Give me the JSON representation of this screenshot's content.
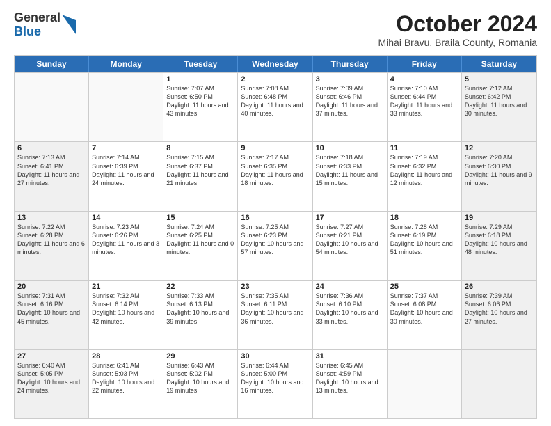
{
  "header": {
    "logo": {
      "general": "General",
      "blue": "Blue"
    },
    "month": "October 2024",
    "location": "Mihai Bravu, Braila County, Romania"
  },
  "weekdays": [
    "Sunday",
    "Monday",
    "Tuesday",
    "Wednesday",
    "Thursday",
    "Friday",
    "Saturday"
  ],
  "rows": [
    [
      {
        "day": "",
        "empty": true,
        "shaded": false
      },
      {
        "day": "",
        "empty": true,
        "shaded": false
      },
      {
        "day": "1",
        "empty": false,
        "shaded": false,
        "sunrise": "Sunrise: 7:07 AM",
        "sunset": "Sunset: 6:50 PM",
        "daylight": "Daylight: 11 hours and 43 minutes."
      },
      {
        "day": "2",
        "empty": false,
        "shaded": false,
        "sunrise": "Sunrise: 7:08 AM",
        "sunset": "Sunset: 6:48 PM",
        "daylight": "Daylight: 11 hours and 40 minutes."
      },
      {
        "day": "3",
        "empty": false,
        "shaded": false,
        "sunrise": "Sunrise: 7:09 AM",
        "sunset": "Sunset: 6:46 PM",
        "daylight": "Daylight: 11 hours and 37 minutes."
      },
      {
        "day": "4",
        "empty": false,
        "shaded": false,
        "sunrise": "Sunrise: 7:10 AM",
        "sunset": "Sunset: 6:44 PM",
        "daylight": "Daylight: 11 hours and 33 minutes."
      },
      {
        "day": "5",
        "empty": false,
        "shaded": true,
        "sunrise": "Sunrise: 7:12 AM",
        "sunset": "Sunset: 6:42 PM",
        "daylight": "Daylight: 11 hours and 30 minutes."
      }
    ],
    [
      {
        "day": "6",
        "empty": false,
        "shaded": true,
        "sunrise": "Sunrise: 7:13 AM",
        "sunset": "Sunset: 6:41 PM",
        "daylight": "Daylight: 11 hours and 27 minutes."
      },
      {
        "day": "7",
        "empty": false,
        "shaded": false,
        "sunrise": "Sunrise: 7:14 AM",
        "sunset": "Sunset: 6:39 PM",
        "daylight": "Daylight: 11 hours and 24 minutes."
      },
      {
        "day": "8",
        "empty": false,
        "shaded": false,
        "sunrise": "Sunrise: 7:15 AM",
        "sunset": "Sunset: 6:37 PM",
        "daylight": "Daylight: 11 hours and 21 minutes."
      },
      {
        "day": "9",
        "empty": false,
        "shaded": false,
        "sunrise": "Sunrise: 7:17 AM",
        "sunset": "Sunset: 6:35 PM",
        "daylight": "Daylight: 11 hours and 18 minutes."
      },
      {
        "day": "10",
        "empty": false,
        "shaded": false,
        "sunrise": "Sunrise: 7:18 AM",
        "sunset": "Sunset: 6:33 PM",
        "daylight": "Daylight: 11 hours and 15 minutes."
      },
      {
        "day": "11",
        "empty": false,
        "shaded": false,
        "sunrise": "Sunrise: 7:19 AM",
        "sunset": "Sunset: 6:32 PM",
        "daylight": "Daylight: 11 hours and 12 minutes."
      },
      {
        "day": "12",
        "empty": false,
        "shaded": true,
        "sunrise": "Sunrise: 7:20 AM",
        "sunset": "Sunset: 6:30 PM",
        "daylight": "Daylight: 11 hours and 9 minutes."
      }
    ],
    [
      {
        "day": "13",
        "empty": false,
        "shaded": true,
        "sunrise": "Sunrise: 7:22 AM",
        "sunset": "Sunset: 6:28 PM",
        "daylight": "Daylight: 11 hours and 6 minutes."
      },
      {
        "day": "14",
        "empty": false,
        "shaded": false,
        "sunrise": "Sunrise: 7:23 AM",
        "sunset": "Sunset: 6:26 PM",
        "daylight": "Daylight: 11 hours and 3 minutes."
      },
      {
        "day": "15",
        "empty": false,
        "shaded": false,
        "sunrise": "Sunrise: 7:24 AM",
        "sunset": "Sunset: 6:25 PM",
        "daylight": "Daylight: 11 hours and 0 minutes."
      },
      {
        "day": "16",
        "empty": false,
        "shaded": false,
        "sunrise": "Sunrise: 7:25 AM",
        "sunset": "Sunset: 6:23 PM",
        "daylight": "Daylight: 10 hours and 57 minutes."
      },
      {
        "day": "17",
        "empty": false,
        "shaded": false,
        "sunrise": "Sunrise: 7:27 AM",
        "sunset": "Sunset: 6:21 PM",
        "daylight": "Daylight: 10 hours and 54 minutes."
      },
      {
        "day": "18",
        "empty": false,
        "shaded": false,
        "sunrise": "Sunrise: 7:28 AM",
        "sunset": "Sunset: 6:19 PM",
        "daylight": "Daylight: 10 hours and 51 minutes."
      },
      {
        "day": "19",
        "empty": false,
        "shaded": true,
        "sunrise": "Sunrise: 7:29 AM",
        "sunset": "Sunset: 6:18 PM",
        "daylight": "Daylight: 10 hours and 48 minutes."
      }
    ],
    [
      {
        "day": "20",
        "empty": false,
        "shaded": true,
        "sunrise": "Sunrise: 7:31 AM",
        "sunset": "Sunset: 6:16 PM",
        "daylight": "Daylight: 10 hours and 45 minutes."
      },
      {
        "day": "21",
        "empty": false,
        "shaded": false,
        "sunrise": "Sunrise: 7:32 AM",
        "sunset": "Sunset: 6:14 PM",
        "daylight": "Daylight: 10 hours and 42 minutes."
      },
      {
        "day": "22",
        "empty": false,
        "shaded": false,
        "sunrise": "Sunrise: 7:33 AM",
        "sunset": "Sunset: 6:13 PM",
        "daylight": "Daylight: 10 hours and 39 minutes."
      },
      {
        "day": "23",
        "empty": false,
        "shaded": false,
        "sunrise": "Sunrise: 7:35 AM",
        "sunset": "Sunset: 6:11 PM",
        "daylight": "Daylight: 10 hours and 36 minutes."
      },
      {
        "day": "24",
        "empty": false,
        "shaded": false,
        "sunrise": "Sunrise: 7:36 AM",
        "sunset": "Sunset: 6:10 PM",
        "daylight": "Daylight: 10 hours and 33 minutes."
      },
      {
        "day": "25",
        "empty": false,
        "shaded": false,
        "sunrise": "Sunrise: 7:37 AM",
        "sunset": "Sunset: 6:08 PM",
        "daylight": "Daylight: 10 hours and 30 minutes."
      },
      {
        "day": "26",
        "empty": false,
        "shaded": true,
        "sunrise": "Sunrise: 7:39 AM",
        "sunset": "Sunset: 6:06 PM",
        "daylight": "Daylight: 10 hours and 27 minutes."
      }
    ],
    [
      {
        "day": "27",
        "empty": false,
        "shaded": true,
        "sunrise": "Sunrise: 6:40 AM",
        "sunset": "Sunset: 5:05 PM",
        "daylight": "Daylight: 10 hours and 24 minutes."
      },
      {
        "day": "28",
        "empty": false,
        "shaded": false,
        "sunrise": "Sunrise: 6:41 AM",
        "sunset": "Sunset: 5:03 PM",
        "daylight": "Daylight: 10 hours and 22 minutes."
      },
      {
        "day": "29",
        "empty": false,
        "shaded": false,
        "sunrise": "Sunrise: 6:43 AM",
        "sunset": "Sunset: 5:02 PM",
        "daylight": "Daylight: 10 hours and 19 minutes."
      },
      {
        "day": "30",
        "empty": false,
        "shaded": false,
        "sunrise": "Sunrise: 6:44 AM",
        "sunset": "Sunset: 5:00 PM",
        "daylight": "Daylight: 10 hours and 16 minutes."
      },
      {
        "day": "31",
        "empty": false,
        "shaded": false,
        "sunrise": "Sunrise: 6:45 AM",
        "sunset": "Sunset: 4:59 PM",
        "daylight": "Daylight: 10 hours and 13 minutes."
      },
      {
        "day": "",
        "empty": true,
        "shaded": false
      },
      {
        "day": "",
        "empty": true,
        "shaded": true
      }
    ]
  ]
}
